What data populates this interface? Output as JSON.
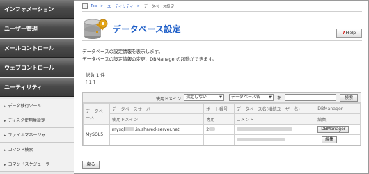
{
  "sidebar": {
    "items": [
      {
        "label": "インフォメーション"
      },
      {
        "label": "ユーザー管理"
      },
      {
        "label": "メールコントロール"
      },
      {
        "label": "ウェブコントロール"
      },
      {
        "label": "ユーティリティ"
      }
    ],
    "sub_items": [
      {
        "label": "データ移行ツール"
      },
      {
        "label": "ディスク使用量設定"
      },
      {
        "label": "ファイルマネージャ"
      },
      {
        "label": "コマンド検索"
      },
      {
        "label": "コマンドスケジューラ"
      }
    ]
  },
  "breadcrumb": {
    "top": "Top",
    "parent": "ユーティリティ",
    "current": "データベース設定",
    "separator": ">"
  },
  "header": {
    "title": "データベース設定",
    "help_label": "Help"
  },
  "description": {
    "line1": "データベースの設定情報を表示します。",
    "line2": "データベースの設定情報の変更、DBManagerの起動ができます。"
  },
  "pagination": {
    "total": "総数 1 件",
    "pages": "[ 1 ]"
  },
  "filter": {
    "domain_label": "使用ドメイン",
    "domain_value": "指定しない",
    "field_value": "データベース名",
    "eq_label": "を",
    "search_label": "検索"
  },
  "table": {
    "headers": {
      "database": "データベース",
      "server": "データベースサーバー",
      "port": "ポート番号",
      "dbname": "データベース名(接続ユーザー名)",
      "dbmanager": "DBManager",
      "domain": "使用ドメイン",
      "dedicated": "専用",
      "comment": "コメント",
      "edit": "編集"
    },
    "row": {
      "type": "MySQL5",
      "host_prefix": "mysql",
      "host_suffix": ".in.shared-server.net",
      "port_prefix": "2",
      "dbmanager_button": "DBManager",
      "edit_button": "編集"
    }
  },
  "back_label": "戻る",
  "colors": {
    "nav_dark": "#3b3b3b",
    "title_blue": "#1f5fc8",
    "link_blue": "#2a5bc7"
  }
}
